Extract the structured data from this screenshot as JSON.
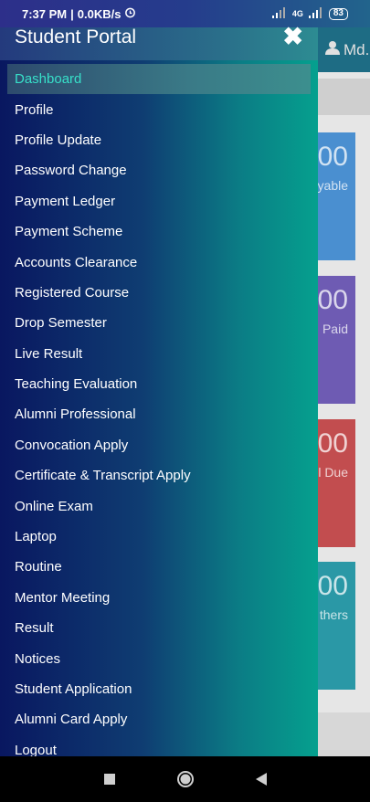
{
  "status_bar": {
    "time": "7:37 PM",
    "speed": "0.0KB/s",
    "network": "4G",
    "battery": "83"
  },
  "background": {
    "user_label": "Md.",
    "cards": [
      {
        "number": "00",
        "label": "yable",
        "color": "#4a8fd0"
      },
      {
        "number": "00",
        "label": "Paid",
        "color": "#6e5bb3"
      },
      {
        "number": "00",
        "label": "l Due",
        "color": "#c24d4f"
      },
      {
        "number": "00",
        "label": "thers",
        "color": "#2a98a6"
      }
    ]
  },
  "drawer": {
    "title": "Student Portal",
    "close_icon": "close-icon",
    "menu": [
      "Dashboard",
      "Profile",
      "Profile Update",
      "Password Change",
      "Payment Ledger",
      "Payment Scheme",
      "Accounts Clearance",
      "Registered Course",
      "Drop Semester",
      "Live Result",
      "Teaching Evaluation",
      "Alumni Professional",
      "Convocation Apply",
      "Certificate & Transcript Apply",
      "Online Exam",
      "Laptop",
      "Routine",
      "Mentor Meeting",
      "Result",
      "Notices",
      "Student Application",
      "Alumni Card Apply",
      "Logout"
    ],
    "active_index": 0,
    "active_color": "#37e0c9"
  },
  "nav_bar": {
    "buttons": [
      "recent-apps-icon",
      "home-icon",
      "back-icon"
    ]
  }
}
